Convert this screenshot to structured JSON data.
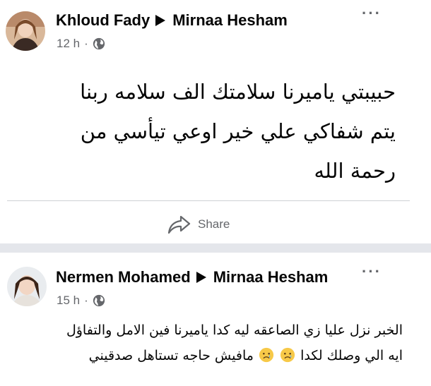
{
  "posts": [
    {
      "author": "Khloud Fady",
      "recipient": "Mirnaa Hesham",
      "time": "12 h",
      "separator": "·",
      "body_lines": [
        "حبيبتي ياميرنا سلامتك الف سلامه ربنا",
        "يتم شفاكي علي خير اوعي تيأسي من",
        "رحمة الله"
      ],
      "share_label": "Share"
    },
    {
      "author": "Nermen Mohamed",
      "recipient": "Mirnaa Hesham",
      "time": "15 h",
      "separator": "·",
      "body_line1": "الخبر نزل عليا زي الصاعقه ليه كدا ياميرنا فين الامل والتفاؤل",
      "body_line2_a": "ايه الي وصلك لكدا",
      "body_line2_b": "مافيش حاجه تستاهل صدقيني"
    }
  ],
  "more_label": "···",
  "colors": {
    "text": "#050505",
    "meta": "#65676b",
    "separator": "#e4e6eb"
  }
}
